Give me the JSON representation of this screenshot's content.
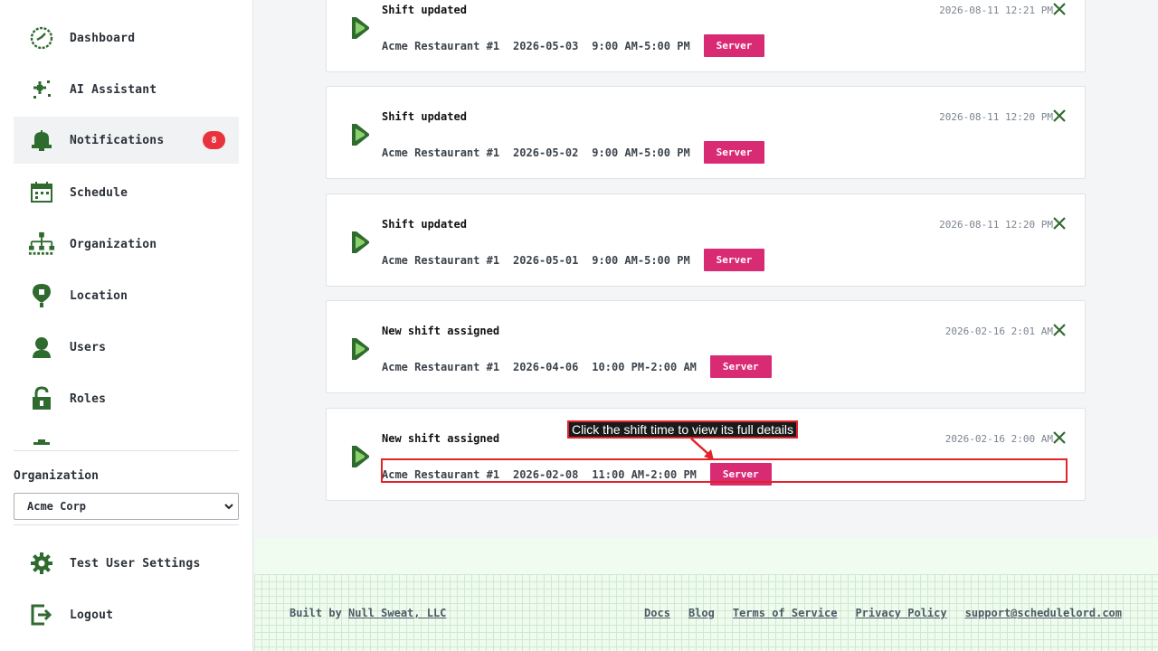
{
  "sidebar": {
    "items": [
      {
        "label": "Dashboard",
        "icon": "dashboard-icon"
      },
      {
        "label": "AI Assistant",
        "icon": "sparkle-icon"
      },
      {
        "label": "Notifications",
        "icon": "bell-icon",
        "badge": "8",
        "active": true
      },
      {
        "label": "Schedule",
        "icon": "calendar-icon"
      },
      {
        "label": "Organization",
        "icon": "org-chart-icon"
      },
      {
        "label": "Location",
        "icon": "map-pin-icon"
      },
      {
        "label": "Users",
        "icon": "user-icon"
      },
      {
        "label": "Roles",
        "icon": "lock-icon"
      }
    ],
    "organization_label": "Organization",
    "organization_value": "Acme Corp",
    "settings_label": "Test User Settings",
    "logout_label": "Logout"
  },
  "notifications": [
    {
      "title": "Shift updated",
      "timestamp": "2026-08-11 12:21 PM",
      "location": "Acme Restaurant #1",
      "date": "2026-05-03",
      "time": "9:00 AM-5:00 PM",
      "role": "Server"
    },
    {
      "title": "Shift updated",
      "timestamp": "2026-08-11 12:20 PM",
      "location": "Acme Restaurant #1",
      "date": "2026-05-02",
      "time": "9:00 AM-5:00 PM",
      "role": "Server"
    },
    {
      "title": "Shift updated",
      "timestamp": "2026-08-11 12:20 PM",
      "location": "Acme Restaurant #1",
      "date": "2026-05-01",
      "time": "9:00 AM-5:00 PM",
      "role": "Server"
    },
    {
      "title": "New shift assigned",
      "timestamp": "2026-02-16 2:01 AM",
      "location": "Acme Restaurant #1",
      "date": "2026-04-06",
      "time": "10:00 PM-2:00 AM",
      "role": "Server"
    },
    {
      "title": "New shift assigned",
      "timestamp": "2026-02-16 2:00 AM",
      "location": "Acme Restaurant #1",
      "date": "2026-02-08",
      "time": "11:00 AM-2:00 PM",
      "role": "Server"
    }
  ],
  "hint": {
    "text": "Click the shift time to view its full details"
  },
  "footer": {
    "built_by_prefix": "Built by",
    "built_by_link": "Null Sweat, LLC",
    "links": [
      "Docs",
      "Blog",
      "Terms of Service",
      "Privacy Policy",
      "support@schedulelord.com"
    ]
  },
  "colors": {
    "accent_green": "#2f6b2f",
    "role_tag": "#d92b74",
    "badge": "#e8323c",
    "hint_red": "#e4222a"
  }
}
